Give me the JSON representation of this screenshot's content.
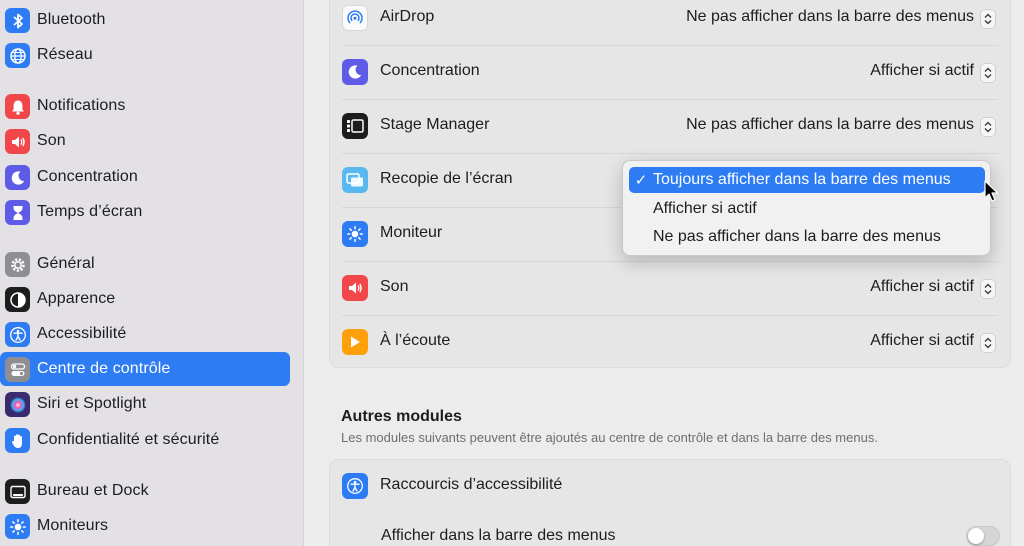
{
  "sidebar": {
    "items": [
      {
        "label": "Bluetooth",
        "icon": "bluetooth-icon",
        "color": "#2d7cf4"
      },
      {
        "label": "Réseau",
        "icon": "globe-icon",
        "color": "#2d7cf4"
      },
      {
        "label": "Notifications",
        "icon": "bell-icon",
        "color": "#f2474a"
      },
      {
        "label": "Son",
        "icon": "speaker-icon",
        "color": "#f2474a"
      },
      {
        "label": "Concentration",
        "icon": "moon-icon",
        "color": "#5e5ce6"
      },
      {
        "label": "Temps d’écran",
        "icon": "hourglass-icon",
        "color": "#5e5ce6"
      },
      {
        "label": "Général",
        "icon": "gear-icon",
        "color": "#8e8e93"
      },
      {
        "label": "Apparence",
        "icon": "appearance-icon",
        "color": "#1d1d1f"
      },
      {
        "label": "Accessibilité",
        "icon": "accessibility-icon",
        "color": "#2d7cf4"
      },
      {
        "label": "Centre de contrôle",
        "icon": "control-center-icon",
        "color": "#8e8e93"
      },
      {
        "label": "Siri et Spotlight",
        "icon": "siri-icon",
        "color": "#3a2a6e"
      },
      {
        "label": "Confidentialité et sécurité",
        "icon": "hand-icon",
        "color": "#2d7cf4"
      },
      {
        "label": "Bureau et Dock",
        "icon": "dock-icon",
        "color": "#1d1d1f"
      },
      {
        "label": "Moniteurs",
        "icon": "sun-icon",
        "color": "#2d7cf4"
      }
    ],
    "selected": "Centre de contrôle"
  },
  "modules": {
    "rows": [
      {
        "label": "AirDrop",
        "value": "Ne pas afficher dans la barre des menus",
        "icon": "airdrop-icon"
      },
      {
        "label": "Concentration",
        "value": "Afficher si actif",
        "icon": "moon-icon"
      },
      {
        "label": "Stage Manager",
        "value": "Ne pas afficher dans la barre des menus",
        "icon": "stage-manager-icon"
      },
      {
        "label": "Recopie de l’écran",
        "value": "",
        "icon": "screen-mirroring-icon"
      },
      {
        "label": "Moniteur",
        "value": "",
        "icon": "sun-icon"
      },
      {
        "label": "Son",
        "value": "Afficher si actif",
        "icon": "speaker-icon"
      },
      {
        "label": "À l’écoute",
        "value": "Afficher si actif",
        "icon": "play-icon"
      }
    ]
  },
  "popup_menu": {
    "items": [
      {
        "label": "Toujours afficher dans la barre des menus",
        "checked": true
      },
      {
        "label": "Afficher si actif",
        "checked": false
      },
      {
        "label": "Ne pas afficher dans la barre des menus",
        "checked": false
      }
    ],
    "check_glyph": "✓"
  },
  "other_modules": {
    "title": "Autres modules",
    "subtitle": "Les modules suivants peuvent être ajoutés au centre de contrôle et dans la barre des menus.",
    "accessibility_shortcuts": {
      "label": "Raccourcis d’accessibilité",
      "icon": "accessibility-icon"
    },
    "show_in_menu_bar": {
      "label": "Afficher dans la barre des menus",
      "enabled": false
    }
  },
  "colors": {
    "accent": "#2d7cf4"
  }
}
